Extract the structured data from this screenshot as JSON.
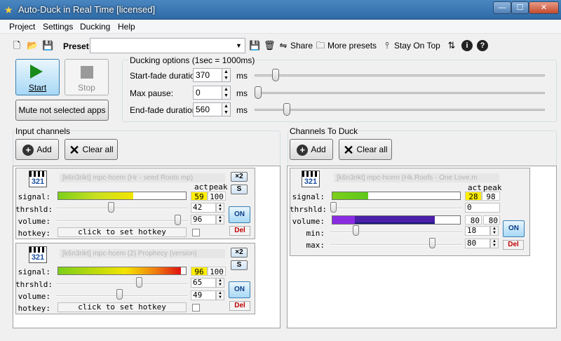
{
  "window": {
    "title": "Auto-Duck in Real Time [licensed]",
    "min": "—",
    "max": "☐",
    "close": "✕"
  },
  "menu": [
    "Project",
    "Settings",
    "Ducking",
    "Help"
  ],
  "toolbar": {
    "preset_label": "Preset:",
    "preset_value": "",
    "share": "Share",
    "more_presets": "More presets",
    "stay_on_top": "Stay On Top"
  },
  "controls": {
    "start": "Start",
    "stop": "Stop",
    "mute": "Mute not selected apps"
  },
  "ducking": {
    "title": "Ducking options (1sec = 1000ms)",
    "fields": [
      {
        "label": "Start-fade duration:",
        "value": "370",
        "unit": "ms",
        "level": 0.06
      },
      {
        "label": "Max pause:",
        "value": "0",
        "unit": "ms",
        "level": 0.0
      },
      {
        "label": "End-fade duration:",
        "value": "560",
        "unit": "ms",
        "level": 0.1
      }
    ]
  },
  "input": {
    "title": "Input channels",
    "add": "Add",
    "clear": "Clear all",
    "channels": [
      {
        "name": "[k6n3rikt] mpc-hcem (Hr - seed Roots mp)",
        "act": "59",
        "peak": "100",
        "signal": 0.59,
        "thrshld": "42",
        "thr_level": 0.42,
        "volume": "96",
        "vol_level": 0.96,
        "hotkey": "click to set hotkey",
        "x2": "×2",
        "s": "S",
        "on": "ON",
        "del": "Del"
      },
      {
        "name": "[k6n3rikt] mpc-hcem (2) Prophecy (version)",
        "act": "96",
        "peak": "100",
        "signal": 0.96,
        "thrshld": "65",
        "thr_level": 0.65,
        "volume": "49",
        "vol_level": 0.49,
        "hotkey": "click to set hotkey",
        "x2": "×2",
        "s": "S",
        "on": "ON",
        "del": "Del"
      }
    ],
    "labels": {
      "signal": "signal:",
      "thrshld": "thrshld:",
      "volume": "volume:",
      "hotkey": "hotkey:",
      "act": "act",
      "peak": "peak"
    }
  },
  "duck": {
    "title": "Channels To Duck",
    "add": "Add",
    "clear": "Clear all",
    "channel": {
      "name": "[k6n3rikt] mpc-hcem (Hk.Roofs - One Love.m",
      "act": "28",
      "peak": "98",
      "signal": 0.28,
      "thrshld": "0",
      "thr_level": 0.0,
      "volume_a": "80",
      "volume_b": "80",
      "vol_level": 0.8,
      "min": "18",
      "min_level": 0.18,
      "max": "80",
      "max_level": 0.8,
      "on": "ON",
      "del": "Del"
    },
    "labels": {
      "signal": "signal:",
      "thrshld": "thrshld:",
      "volume": "volume:",
      "min": "min:",
      "max": "max:",
      "act": "act",
      "peak": "peak"
    }
  },
  "colors": {
    "accent": "#3c7fb1",
    "act_bg": "#ffee00",
    "volume_purple": "#8a2be2"
  }
}
